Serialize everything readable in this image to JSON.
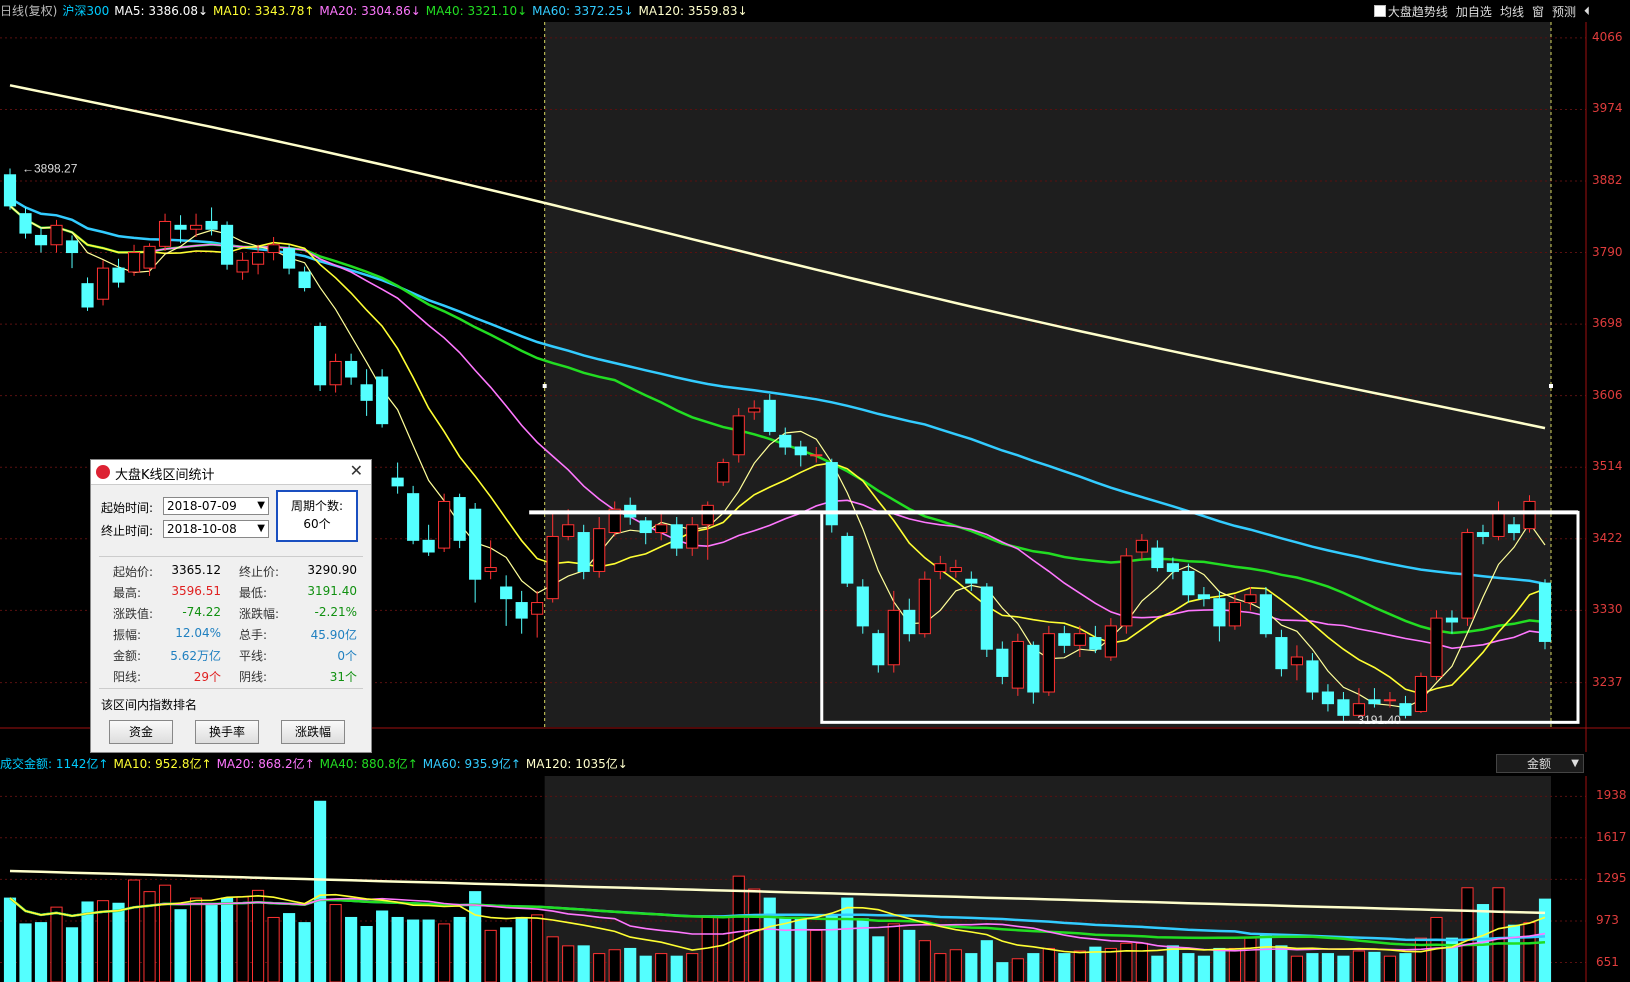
{
  "header": {
    "items": [
      {
        "text": "日线(复权)",
        "color": "#bbbbbb"
      },
      {
        "text": "沪深300",
        "color": "#00ccff"
      },
      {
        "text": "MA5: 3386.08↓",
        "color": "#ffffff"
      },
      {
        "text": "MA10: 3343.78↑",
        "color": "#ffff33"
      },
      {
        "text": "MA20: 3304.86↓",
        "color": "#ff77ff"
      },
      {
        "text": "MA40: 3321.10↓",
        "color": "#22dd22"
      },
      {
        "text": "MA60: 3372.25↓",
        "color": "#33ccff"
      },
      {
        "text": "MA120: 3559.83↓",
        "color": "#ffffcc"
      }
    ],
    "right_buttons": [
      "大盘趋势线",
      "加自选",
      "均线",
      "窗",
      "预测"
    ],
    "collapse_icon": "double-chevron-left-icon"
  },
  "price_axis": [
    "4066",
    "3974",
    "3882",
    "3790",
    "3698",
    "3606",
    "3514",
    "3422",
    "3330",
    "3237"
  ],
  "volume_header": {
    "items": [
      {
        "text": "成交金额: 1142亿↑",
        "color": "#00ccff"
      },
      {
        "text": "MA10: 952.8亿↑",
        "color": "#ffff33"
      },
      {
        "text": "MA20: 868.2亿↑",
        "color": "#ff77ff"
      },
      {
        "text": "MA40: 880.8亿↑",
        "color": "#22dd22"
      },
      {
        "text": "MA60: 935.9亿↑",
        "color": "#33ccff"
      },
      {
        "text": "MA120: 1035亿↓",
        "color": "#ffffcc"
      }
    ],
    "select_value": "金额"
  },
  "volume_axis": [
    "1938",
    "1617",
    "1295",
    "973",
    "651"
  ],
  "dialog": {
    "title": "大盘K线区间统计",
    "start_label": "起始时间:",
    "start_value": "2018-07-09",
    "end_label": "终止时间:",
    "end_value": "2018-10-08",
    "period_label": "周期个数:",
    "period_value": "60个",
    "stats": [
      {
        "label": "起始价:",
        "value": "3365.12",
        "color": "#000000"
      },
      {
        "label": "终止价:",
        "value": "3290.90",
        "color": "#000000"
      },
      {
        "label": "最高:",
        "value": "3596.51",
        "color": "#e02020"
      },
      {
        "label": "最低:",
        "value": "3191.40",
        "color": "#109010"
      },
      {
        "label": "涨跌值:",
        "value": "-74.22",
        "color": "#109010"
      },
      {
        "label": "涨跌幅:",
        "value": "-2.21%",
        "color": "#109010"
      },
      {
        "label": "振幅:",
        "value": "12.04%",
        "color": "#2080c0"
      },
      {
        "label": "总手:",
        "value": "45.90亿",
        "color": "#2080c0"
      },
      {
        "label": "金额:",
        "value": "5.62万亿",
        "color": "#2080c0"
      },
      {
        "label": "平线:",
        "value": "0个",
        "color": "#2080c0"
      },
      {
        "label": "阳线:",
        "value": "29个",
        "color": "#e02020"
      },
      {
        "label": "阴线:",
        "value": "31个",
        "color": "#109010"
      }
    ],
    "section_title": "该区间内指数排名",
    "buttons": [
      "资金",
      "换手率",
      "涨跌幅"
    ]
  },
  "chart_data": {
    "type": "candlestick",
    "price_ylim": [
      3180,
      4080
    ],
    "volume_ylim": [
      500,
      2000
    ],
    "annotations": {
      "high_label": "3898.27",
      "low_label": "3191.40"
    },
    "candles": [
      [
        3890,
        3850,
        3898,
        3845,
        1150
      ],
      [
        3840,
        3815,
        3848,
        3808,
        950
      ],
      [
        3812,
        3800,
        3822,
        3790,
        960
      ],
      [
        3800,
        3825,
        3832,
        3790,
        1080
      ],
      [
        3805,
        3790,
        3812,
        3770,
        920
      ],
      [
        3750,
        3720,
        3758,
        3715,
        1120
      ],
      [
        3730,
        3770,
        3780,
        3722,
        1130
      ],
      [
        3770,
        3752,
        3782,
        3745,
        1110
      ],
      [
        3765,
        3790,
        3800,
        3760,
        1290
      ],
      [
        3770,
        3798,
        3802,
        3760,
        1200
      ],
      [
        3798,
        3830,
        3840,
        3792,
        1250
      ],
      [
        3825,
        3820,
        3838,
        3802,
        1060
      ],
      [
        3820,
        3825,
        3840,
        3810,
        1150
      ],
      [
        3830,
        3820,
        3848,
        3812,
        1100
      ],
      [
        3825,
        3775,
        3830,
        3768,
        1150
      ],
      [
        3765,
        3780,
        3790,
        3755,
        1160
      ],
      [
        3775,
        3790,
        3800,
        3762,
        1210
      ],
      [
        3790,
        3800,
        3810,
        3780,
        1000
      ],
      [
        3795,
        3770,
        3800,
        3762,
        1030
      ],
      [
        3765,
        3745,
        3772,
        3740,
        960
      ],
      [
        3695,
        3620,
        3700,
        3612,
        1900
      ],
      [
        3620,
        3650,
        3660,
        3610,
        1100
      ],
      [
        3650,
        3630,
        3660,
        3620,
        1000
      ],
      [
        3620,
        3600,
        3640,
        3580,
        930
      ],
      [
        3630,
        3570,
        3640,
        3565,
        1050
      ],
      [
        3500,
        3490,
        3520,
        3480,
        1000
      ],
      [
        3480,
        3420,
        3490,
        3415,
        980
      ],
      [
        3420,
        3405,
        3440,
        3400,
        980
      ],
      [
        3410,
        3470,
        3480,
        3405,
        950
      ],
      [
        3475,
        3420,
        3480,
        3410,
        1000
      ],
      [
        3460,
        3370,
        3468,
        3340,
        1200
      ],
      [
        3380,
        3385,
        3420,
        3370,
        900
      ],
      [
        3360,
        3345,
        3375,
        3310,
        920
      ],
      [
        3340,
        3320,
        3355,
        3300,
        1000
      ],
      [
        3325,
        3340,
        3355,
        3295,
        1020
      ],
      [
        3345,
        3425,
        3455,
        3340,
        850
      ],
      [
        3425,
        3440,
        3460,
        3420,
        780
      ],
      [
        3430,
        3380,
        3440,
        3370,
        780
      ],
      [
        3380,
        3435,
        3450,
        3372,
        720
      ],
      [
        3430,
        3460,
        3470,
        3425,
        750
      ],
      [
        3465,
        3450,
        3475,
        3440,
        760
      ],
      [
        3445,
        3430,
        3450,
        3415,
        700
      ],
      [
        3430,
        3440,
        3458,
        3420,
        720
      ],
      [
        3440,
        3410,
        3450,
        3400,
        700
      ],
      [
        3410,
        3440,
        3450,
        3400,
        720
      ],
      [
        3440,
        3465,
        3470,
        3395,
        1000
      ],
      [
        3495,
        3520,
        3525,
        3490,
        1000
      ],
      [
        3530,
        3580,
        3590,
        3520,
        1320
      ],
      [
        3585,
        3590,
        3600,
        3575,
        1220
      ],
      [
        3600,
        3560,
        3608,
        3555,
        1150
      ],
      [
        3555,
        3540,
        3565,
        3530,
        1000
      ],
      [
        3540,
        3530,
        3548,
        3515,
        1000
      ],
      [
        3530,
        3530,
        3540,
        3520,
        900
      ],
      [
        3520,
        3440,
        3525,
        3430,
        1020
      ],
      [
        3425,
        3365,
        3430,
        3360,
        1150
      ],
      [
        3360,
        3310,
        3370,
        3300,
        990
      ],
      [
        3300,
        3260,
        3305,
        3250,
        850
      ],
      [
        3260,
        3330,
        3355,
        3250,
        950
      ],
      [
        3330,
        3300,
        3345,
        3290,
        900
      ],
      [
        3300,
        3370,
        3380,
        3295,
        820
      ],
      [
        3380,
        3390,
        3400,
        3370,
        720
      ],
      [
        3380,
        3385,
        3395,
        3372,
        750
      ],
      [
        3370,
        3365,
        3380,
        3355,
        720
      ],
      [
        3360,
        3280,
        3365,
        3270,
        820
      ],
      [
        3280,
        3245,
        3290,
        3235,
        650
      ],
      [
        3230,
        3290,
        3300,
        3220,
        680
      ],
      [
        3285,
        3225,
        3290,
        3210,
        720
      ],
      [
        3225,
        3300,
        3310,
        3220,
        760
      ],
      [
        3300,
        3285,
        3310,
        3275,
        720
      ],
      [
        3285,
        3300,
        3310,
        3270,
        740
      ],
      [
        3295,
        3280,
        3310,
        3275,
        770
      ],
      [
        3270,
        3310,
        3320,
        3265,
        760
      ],
      [
        3310,
        3400,
        3410,
        3300,
        800
      ],
      [
        3405,
        3420,
        3428,
        3395,
        800
      ],
      [
        3410,
        3385,
        3420,
        3380,
        700
      ],
      [
        3390,
        3380,
        3398,
        3370,
        780
      ],
      [
        3380,
        3350,
        3390,
        3340,
        720
      ],
      [
        3350,
        3345,
        3360,
        3335,
        700
      ],
      [
        3345,
        3310,
        3355,
        3290,
        760
      ],
      [
        3310,
        3340,
        3350,
        3305,
        760
      ],
      [
        3340,
        3350,
        3360,
        3330,
        840
      ],
      [
        3350,
        3300,
        3360,
        3295,
        860
      ],
      [
        3295,
        3255,
        3305,
        3245,
        780
      ],
      [
        3260,
        3270,
        3285,
        3240,
        700
      ],
      [
        3265,
        3225,
        3275,
        3215,
        720
      ],
      [
        3225,
        3210,
        3235,
        3200,
        720
      ],
      [
        3215,
        3195,
        3225,
        3188,
        700
      ],
      [
        3195,
        3210,
        3230,
        3192,
        740
      ],
      [
        3215,
        3210,
        3230,
        3205,
        730
      ],
      [
        3215,
        3215,
        3225,
        3205,
        700
      ],
      [
        3210,
        3195,
        3220,
        3191,
        720
      ],
      [
        3200,
        3245,
        3250,
        3198,
        840
      ],
      [
        3245,
        3320,
        3330,
        3240,
        1000
      ],
      [
        3320,
        3315,
        3330,
        3300,
        840
      ],
      [
        3320,
        3430,
        3435,
        3310,
        1230
      ],
      [
        3430,
        3425,
        3440,
        3415,
        1100
      ],
      [
        3425,
        3455,
        3470,
        3420,
        1230
      ],
      [
        3440,
        3430,
        3450,
        3420,
        940
      ],
      [
        3435,
        3470,
        3478,
        3430,
        960
      ],
      [
        3365,
        3290,
        3370,
        3280,
        1142
      ]
    ],
    "ma_series": [
      {
        "name": "MA5",
        "color": "#ffffff"
      },
      {
        "name": "MA10",
        "color": "#ffff33"
      },
      {
        "name": "MA20",
        "color": "#ff77ff"
      },
      {
        "name": "MA40",
        "color": "#22dd22"
      },
      {
        "name": "MA60",
        "color": "#33ccff"
      },
      {
        "name": "MA120",
        "color": "#ffffcc"
      }
    ],
    "ma120_start": 4005,
    "ma120_end": 3560,
    "ma60_start": 3872,
    "ma60_end": 3372,
    "selected_range": {
      "start_index": 35,
      "end_index": 99
    }
  }
}
